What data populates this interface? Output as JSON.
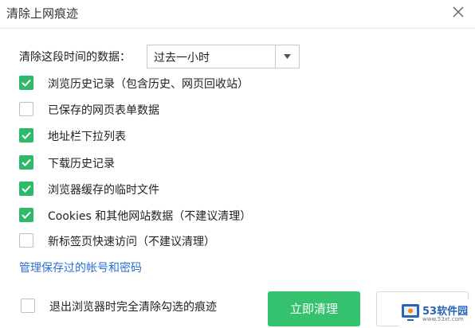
{
  "dialog": {
    "title": "清除上网痕迹",
    "close_icon": "close-icon"
  },
  "time_range": {
    "label": "清除这段时间的数据：",
    "selected": "过去一小时"
  },
  "options": [
    {
      "label": "浏览历史记录（包含历史、网页回收站）",
      "checked": true
    },
    {
      "label": "已保存的网页表单数据",
      "checked": false
    },
    {
      "label": "地址栏下拉列表",
      "checked": true
    },
    {
      "label": "下载历史记录",
      "checked": true
    },
    {
      "label": "浏览器缓存的临时文件",
      "checked": true
    },
    {
      "label": "Cookies 和其他网站数据（不建议清理）",
      "checked": true
    },
    {
      "label": "新标签页快速访问（不建议清理）",
      "checked": false
    }
  ],
  "manage_link": "管理保存过的帐号和密码",
  "footer": {
    "exit_clear_label": "退出浏览器时完全清除勾选的痕迹",
    "exit_clear_checked": false,
    "clear_button": "立即清理"
  },
  "watermark": {
    "brand": "53软件园",
    "sub": "www.53xt.com"
  },
  "colors": {
    "checked": "#2fb96a",
    "primary_button": "#34c26f",
    "link": "#2c6fd1"
  }
}
